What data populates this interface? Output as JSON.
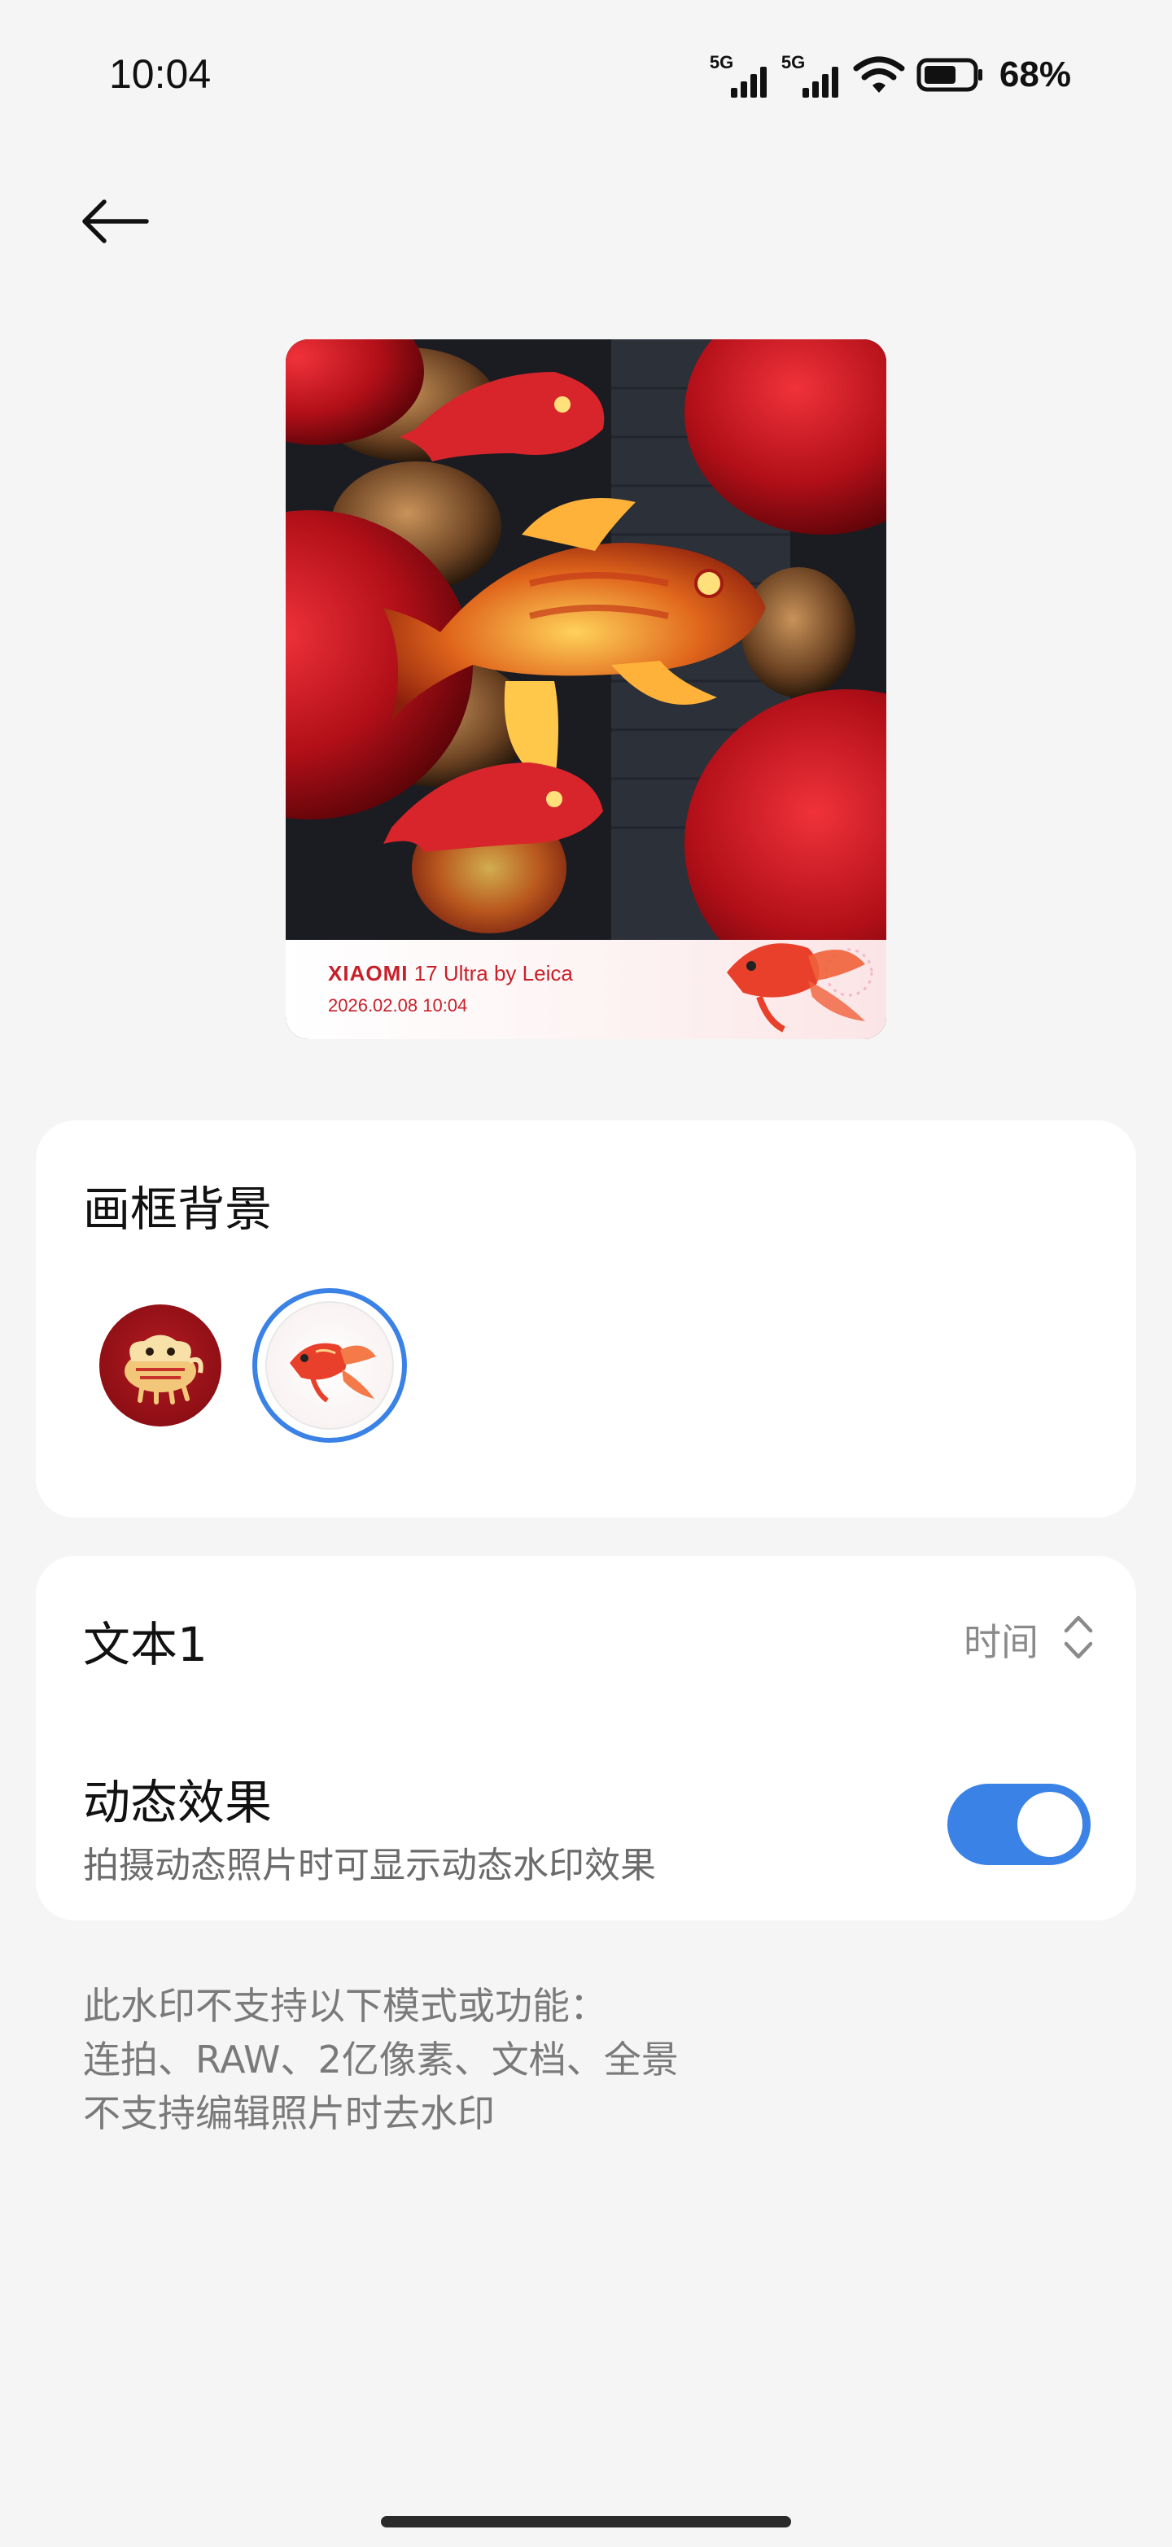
{
  "status_bar": {
    "time": "10:04",
    "sim1_label": "5G",
    "sim2_label": "5G",
    "battery_percent": "68%",
    "battery_level": 0.68,
    "icons": [
      "signal-icon",
      "signal-icon",
      "wifi-icon",
      "battery-icon"
    ]
  },
  "header": {
    "back_icon": "arrow-left-icon"
  },
  "preview": {
    "watermark_brand": "XIAOMI",
    "watermark_model": "17 Ultra",
    "watermark_by": "by Leica",
    "watermark_datetime": "2026.02.08 10:04"
  },
  "frame_background": {
    "title": "画框背景",
    "options": [
      {
        "name": "lion-dance",
        "selected": false
      },
      {
        "name": "goldfish",
        "selected": true
      }
    ]
  },
  "settings": {
    "text1_label": "文本1",
    "text1_value": "时间",
    "dynamic_title": "动态效果",
    "dynamic_subtitle": "拍摄动态照片时可显示动态水印效果",
    "dynamic_enabled": true
  },
  "notes": {
    "line1": "此水印不支持以下模式或功能：",
    "line2": "连拍、RAW、2亿像素、文档、全景",
    "line3": "不支持编辑照片时去水印"
  },
  "colors": {
    "accent": "#3b82e6",
    "watermark_red": "#c8202a",
    "background": "#f5f5f5"
  }
}
